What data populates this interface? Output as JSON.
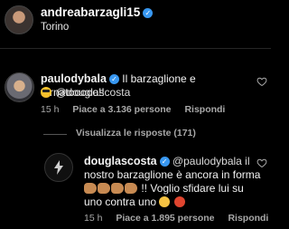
{
  "post": {
    "username": "andreabarzagli15",
    "location": "Torino"
  },
  "comment1": {
    "username": "paulodybala",
    "text": "Il barzaglione e tornatooooo!!",
    "mention": "@douglascosta",
    "time": "15 h",
    "likes": "Piace a 3.136 persone",
    "reply": "Rispondi",
    "view_replies": "Visualizza le risposte (171)"
  },
  "comment2": {
    "username": "douglascosta",
    "line1": "@paulodybala il",
    "line2": "nostro barzaglione è ancora in forma",
    "line3": "!! Voglio sfidare lui su",
    "line4": "uno contra uno",
    "time": "15 h",
    "likes": "Piace a 1.895 persone",
    "reply": "Rispondi"
  },
  "icons": {
    "verified": "verified-badge-icon",
    "heart": "heart-outline-icon"
  },
  "colors": {
    "background": "#000000",
    "verified": "#3897f0",
    "meta": "#a8a8a8"
  }
}
